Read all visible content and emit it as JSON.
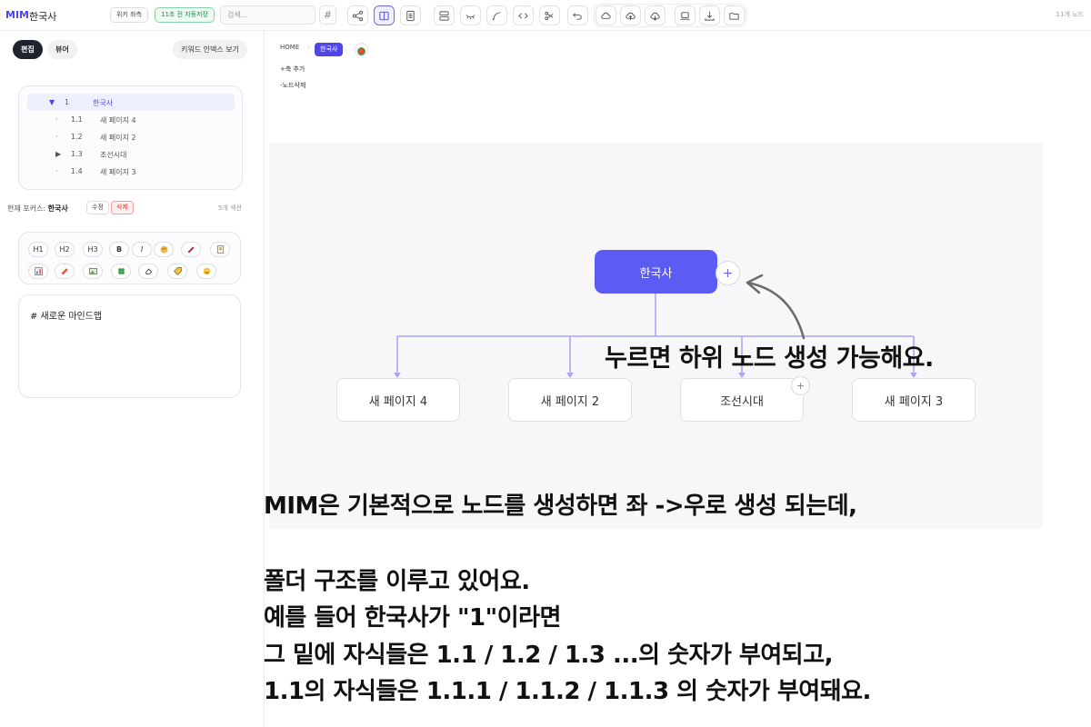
{
  "topbar": {
    "brand": "MIM",
    "title": "한국사",
    "wiki_label": "위키 좌측",
    "autosave_label": "11초 전 자동저장",
    "search_placeholder": "검색...",
    "hash": "#",
    "node_count": "11개 노드"
  },
  "sidebar": {
    "tabs": [
      {
        "label": "편집"
      },
      {
        "label": "뷰어"
      }
    ],
    "keyword_button": "키워드 인덱스 보기",
    "tree": [
      {
        "toggle": "▼",
        "num": "1",
        "label": "한국사"
      },
      {
        "toggle": "·",
        "num": "1.1",
        "label": "새 페이지 4"
      },
      {
        "toggle": "·",
        "num": "1.2",
        "label": "새 페이지 2"
      },
      {
        "toggle": "▶",
        "num": "1.3",
        "label": "조선시대"
      },
      {
        "toggle": "·",
        "num": "1.4",
        "label": "새 페이지 3"
      }
    ],
    "focus_label": "현재 포커스:",
    "focus_value": "한국사",
    "edit_chip": "수정",
    "delete_chip": "삭제",
    "section_count": "5개 섹션",
    "format_row1": [
      "H1",
      "H2",
      "H3",
      "B",
      "I"
    ],
    "editor_text": "# 새로운 마인드맵"
  },
  "main": {
    "breadcrumb_home": "HOME",
    "breadcrumb_current": "한국사",
    "add_child": "+축 추가",
    "delete_node": "-노드삭제",
    "root_node": "한국사",
    "plus": "+",
    "children": [
      "새 페이지 4",
      "새 페이지 2",
      "조선시대",
      "새 페이지 3"
    ]
  },
  "annotations": {
    "callout": "누르면 하위 노드 생성 가능해요.",
    "line1": "MIM은 기본적으로 노드를 생성하면 좌 ->우로 생성 되는데,",
    "line2": "폴더 구조를 이루고 있어요.",
    "line3": "예를 들어 한국사가 \"1\"이라면",
    "line4": "그 밑에 자식들은 1.1 / 1.2 / 1.3 ...의 숫자가 부여되고,",
    "line5": "1.1의 자식들은 1.1.1 / 1.1.2 / 1.1.3 의 숫자가 부여돼요."
  },
  "colors": {
    "accent": "#5c5cf5",
    "connector": "#a9a7f6"
  }
}
